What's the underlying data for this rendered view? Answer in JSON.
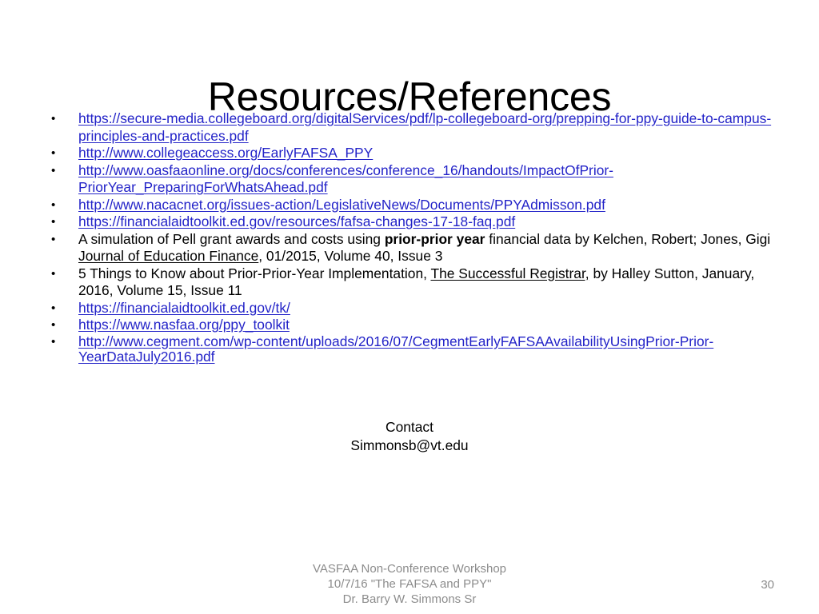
{
  "slide": {
    "title": "Resources/References",
    "bullet_marker": "•",
    "link_color": "#2323c8",
    "footer_color": "#8c8c8c",
    "bullets": [
      {
        "type": "link",
        "text": "https://secure-media.collegeboard.org/digitalServices/pdf/lp-collegeboard-org/prepping-for-ppy-guide-to-campus-principles-and-practices.pdf"
      },
      {
        "type": "link",
        "text": "http://www.collegeaccess.org/EarlyFAFSA_PPY"
      },
      {
        "type": "link",
        "text": "http://www.oasfaaonline.org/docs/conferences/conference_16/handouts/ImpactOfPrior-PriorYear_PreparingForWhatsAhead.pdf"
      },
      {
        "type": "link",
        "text": "http://www.nacacnet.org/issues-action/LegislativeNews/Documents/PPYAdmisson.pdf"
      },
      {
        "type": "link",
        "text": "https://financialaidtoolkit.ed.gov/resources/fafsa-changes-17-18-faq.pdf"
      },
      {
        "type": "citation",
        "parts": [
          {
            "text": "A simulation of Pell grant awards and costs using ",
            "style": "normal"
          },
          {
            "text": "prior-prior year",
            "style": "bold"
          },
          {
            "text": " financial data by Kelchen, Robert; Jones, Gigi ",
            "style": "normal"
          },
          {
            "text": "Journal of Education Finance",
            "style": "underline"
          },
          {
            "text": ", 01/2015, Volume 40, Issue 3",
            "style": "normal"
          }
        ]
      },
      {
        "type": "citation",
        "parts": [
          {
            "text": "5 Things to Know about Prior-Prior-Year Implementation, ",
            "style": "normal"
          },
          {
            "text": "The Successful Registrar,",
            "style": "underline"
          },
          {
            "text": " by Halley Sutton, January, 2016, Volume 15, Issue 11",
            "style": "normal"
          }
        ]
      },
      {
        "type": "link",
        "text": "https://financialaidtoolkit.ed.gov/tk/"
      },
      {
        "type": "link",
        "text": "https://www.nasfaa.org/ppy_toolkit"
      },
      {
        "type": "link",
        "tight": true,
        "text": "http://www.cegment.com/wp-content/uploads/2016/07/CegmentEarlyFAFSAAvailabilityUsingPrior-Prior-YearDataJuly2016.pdf"
      }
    ],
    "contact": {
      "label": "Contact",
      "email": "Simmonsb@vt.edu"
    },
    "footer": {
      "line1": "VASFAA Non-Conference Workshop",
      "line2": "10/7/16 \"The FAFSA and PPY\"",
      "line3": "Dr. Barry W. Simmons Sr",
      "slide_number": "30"
    }
  }
}
